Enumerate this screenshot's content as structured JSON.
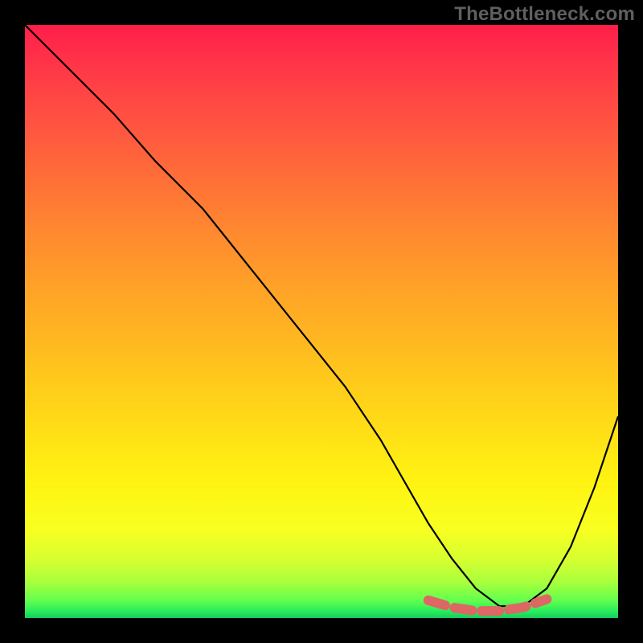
{
  "watermark": "TheBottleneck.com",
  "chart_data": {
    "type": "line",
    "title": "",
    "xlabel": "",
    "ylabel": "",
    "xlim": [
      0,
      100
    ],
    "ylim": [
      0,
      100
    ],
    "series": [
      {
        "name": "bottleneck-curve",
        "color": "#000000",
        "stroke_width": 2.2,
        "x": [
          0,
          3,
          8,
          15,
          22,
          30,
          38,
          46,
          54,
          60,
          64,
          68,
          72,
          76,
          80,
          84,
          88,
          92,
          96,
          100
        ],
        "values": [
          100,
          97,
          92,
          85,
          77,
          69,
          59,
          49,
          39,
          30,
          23,
          16,
          10,
          5,
          2,
          2,
          5,
          12,
          22,
          34
        ]
      },
      {
        "name": "optimal-band",
        "color": "#de6665",
        "stroke_width": 12,
        "linecap": "round",
        "dash": "22 12",
        "x": [
          68,
          72,
          76,
          80,
          84,
          88
        ],
        "values": [
          3,
          1.8,
          1.2,
          1.2,
          1.8,
          3.2
        ]
      }
    ],
    "gradient_stops": [
      {
        "pct": 0,
        "hex": "#ff1e49"
      },
      {
        "pct": 50,
        "hex": "#ffb721"
      },
      {
        "pct": 85,
        "hex": "#f8ff20"
      },
      {
        "pct": 100,
        "hex": "#18c95e"
      }
    ]
  }
}
